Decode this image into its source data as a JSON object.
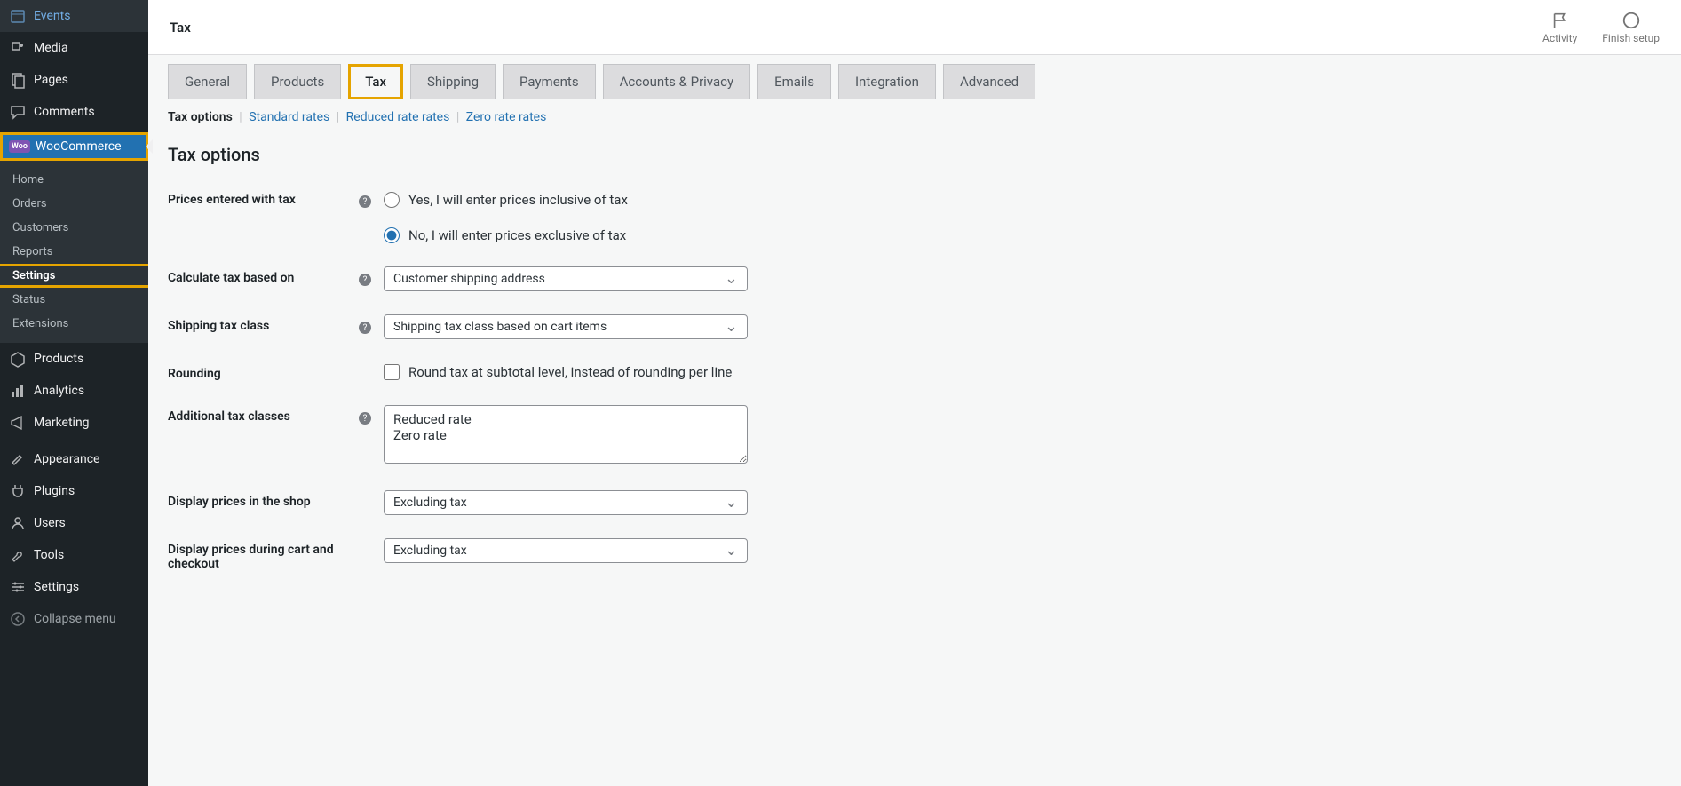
{
  "sidebar": {
    "events": "Events",
    "media": "Media",
    "pages": "Pages",
    "comments": "Comments",
    "woocommerce": "WooCommerce",
    "sub": {
      "home": "Home",
      "orders": "Orders",
      "customers": "Customers",
      "reports": "Reports",
      "settings": "Settings",
      "status": "Status",
      "extensions": "Extensions"
    },
    "products": "Products",
    "analytics": "Analytics",
    "marketing": "Marketing",
    "appearance": "Appearance",
    "plugins": "Plugins",
    "users": "Users",
    "tools": "Tools",
    "settings_main": "Settings",
    "collapse": "Collapse menu"
  },
  "header": {
    "title": "Tax",
    "activity": "Activity",
    "finish": "Finish setup"
  },
  "tabs": {
    "general": "General",
    "products": "Products",
    "tax": "Tax",
    "shipping": "Shipping",
    "payments": "Payments",
    "accounts": "Accounts & Privacy",
    "emails": "Emails",
    "integration": "Integration",
    "advanced": "Advanced"
  },
  "subtabs": {
    "options": "Tax options",
    "standard": "Standard rates",
    "reduced": "Reduced rate rates",
    "zero": "Zero rate rates"
  },
  "content": {
    "heading": "Tax options",
    "prices_label": "Prices entered with tax",
    "radio_yes": "Yes, I will enter prices inclusive of tax",
    "radio_no": "No, I will enter prices exclusive of tax",
    "calc_label": "Calculate tax based on",
    "calc_value": "Customer shipping address",
    "shipclass_label": "Shipping tax class",
    "shipclass_value": "Shipping tax class based on cart items",
    "rounding_label": "Rounding",
    "rounding_check": "Round tax at subtotal level, instead of rounding per line",
    "addl_label": "Additional tax classes",
    "addl_value": "Reduced rate\nZero rate",
    "display_shop_label": "Display prices in the shop",
    "display_shop_value": "Excluding tax",
    "display_cart_label": "Display prices during cart and checkout",
    "display_cart_value": "Excluding tax"
  }
}
